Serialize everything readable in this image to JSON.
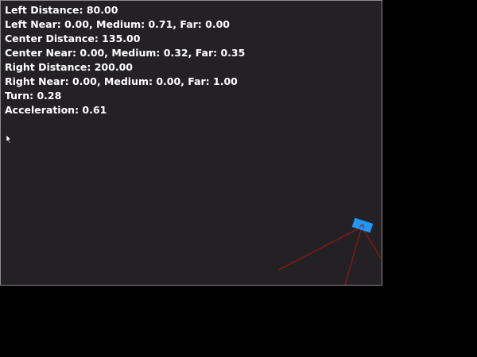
{
  "hud": {
    "left_distance": "Left Distance: 80.00",
    "left_fuzzy": "Left Near: 0.00, Medium: 0.71, Far: 0.00",
    "center_distance": "Center Distance: 135.00",
    "center_fuzzy": "Center Near: 0.00, Medium: 0.32, Far: 0.35",
    "right_distance": "Right Distance: 200.00",
    "right_fuzzy": "Right Near: 0.00, Medium: 0.00, Far: 1.00",
    "turn": "Turn: 0.28",
    "acceleration": "Acceleration: 0.61"
  },
  "colors": {
    "background": "#232124",
    "outer": "#000000",
    "car": "#2196f3",
    "sensor": "#8b1a1a",
    "text": "#ffffff"
  },
  "icons": {
    "cursor": "mouse-pointer-icon",
    "car": "car-icon"
  }
}
